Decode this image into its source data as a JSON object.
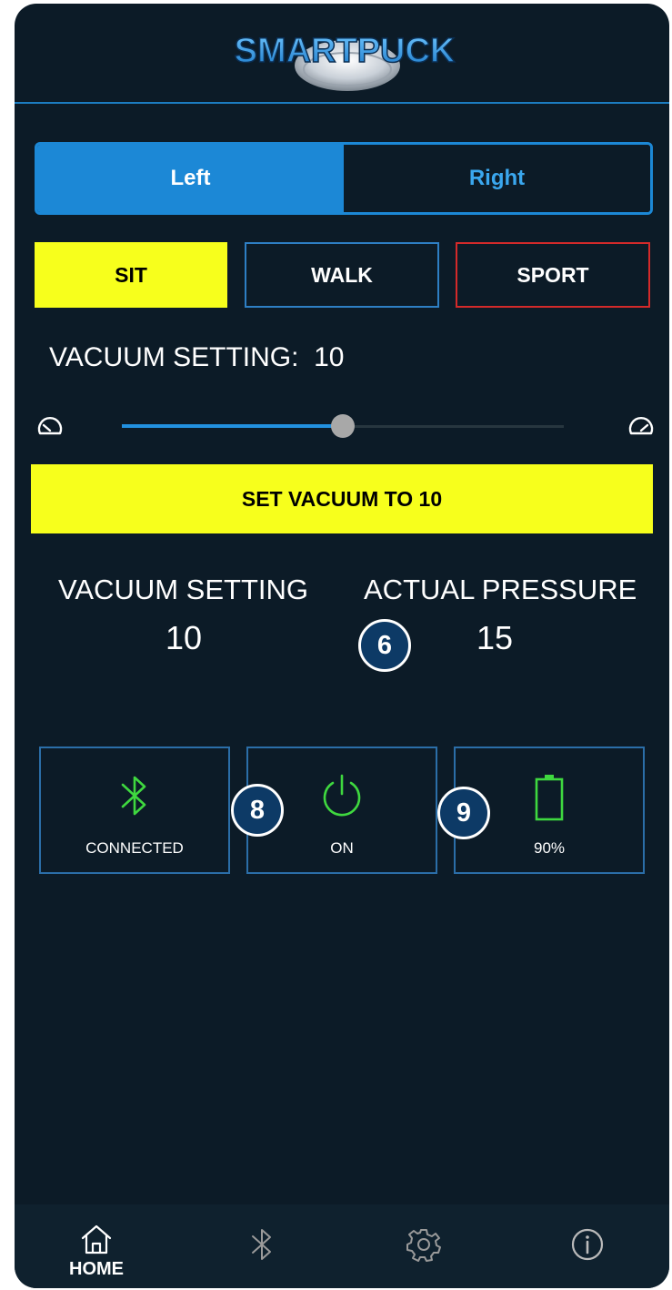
{
  "app": {
    "logo_text": "SMARTPUCK"
  },
  "side_toggle": {
    "left_label": "Left",
    "right_label": "Right",
    "selected": "Left"
  },
  "modes": {
    "sit_label": "SIT",
    "walk_label": "WALK",
    "sport_label": "SPORT",
    "selected": "SIT"
  },
  "vacuum_setting": {
    "label": "VACUUM SETTING:",
    "value": "10"
  },
  "slider": {
    "level": 0.5,
    "left_icon": "gauge-low-icon",
    "right_icon": "gauge-high-icon"
  },
  "set_button": {
    "label": "SET VACUUM TO 10"
  },
  "readings": {
    "vacuum_label": "VACUUM SETTING",
    "vacuum_value": "10",
    "pressure_label": "ACTUAL PRESSURE",
    "pressure_value": "15"
  },
  "callouts": {
    "a": "6",
    "b": "8",
    "c": "9"
  },
  "status_tiles": {
    "bluetooth": {
      "icon": "bluetooth-icon",
      "label": "CONNECTED"
    },
    "power": {
      "icon": "power-icon",
      "label": "ON"
    },
    "battery": {
      "icon": "battery-icon",
      "label": "90%",
      "level": 0.9
    }
  },
  "nav": {
    "home_label": "HOME",
    "items": [
      "home-icon",
      "bluetooth-icon",
      "gear-icon",
      "info-icon"
    ]
  },
  "colors": {
    "background": "#0c1b27",
    "accent_blue": "#1c88d6",
    "yellow": "#f7ff1c",
    "status_green": "#3fd83f",
    "sport_red": "#d42a2a"
  }
}
